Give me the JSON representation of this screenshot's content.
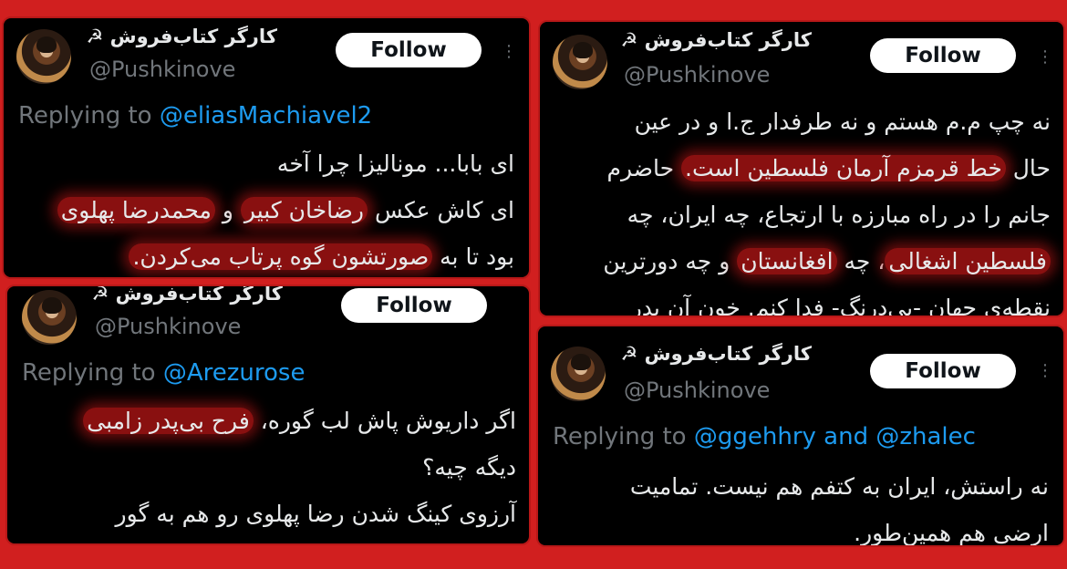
{
  "theme": {
    "background": "#d11f1f",
    "card_background": "#000000",
    "mention_color": "#1d9bf0",
    "highlight_color": "#be1616"
  },
  "tweets": [
    {
      "display_name": "کارگر کتاب‌فروش ☭",
      "handle": "@Pushkinove",
      "follow_label": "Follow",
      "replying_prefix": "Replying to",
      "mentions": [
        "@eliasMachiavel2"
      ],
      "lines": [
        {
          "before": "",
          "highlight": "",
          "after": "ای بابا... مونالیزا چرا آخه"
        },
        {
          "before": "ای کاش عکس ",
          "highlight": "رضاخان کبیر",
          "mid": " و ",
          "highlight2": "محمدرضا پهلوی",
          "after": ""
        },
        {
          "before": "بود تا به ",
          "highlight": "صورتشون گوه پرتاب می‌کردن.",
          "after": ""
        }
      ]
    },
    {
      "display_name": "کارگر کتاب‌فروش ☭",
      "handle": "@Pushkinove",
      "follow_label": "Follow",
      "replying_prefix": "Replying to",
      "mentions": [
        "@Arezurose"
      ],
      "lines": [
        {
          "before": "اگر داریوش پاش لب گوره، ",
          "highlight": "فرح بی‌پدر زامبی",
          "after": ""
        },
        {
          "before": "",
          "highlight": "",
          "after": "دیگه چیه؟"
        },
        {
          "before": "",
          "highlight": "",
          "after": "آرزوی کینگ شدن رضا پهلوی رو هم به گور"
        }
      ]
    },
    {
      "display_name": "کارگر کتاب‌فروش ☭",
      "handle": "@Pushkinove",
      "follow_label": "Follow",
      "lines": [
        {
          "before": "",
          "highlight": "",
          "after": "نه چپ م.م هستم و نه طرفدار ج.ا و در عین"
        },
        {
          "before": "حال ",
          "highlight": "خط قرمزم آرمان فلسطین است.",
          "after": " حاضرم"
        },
        {
          "before": "",
          "highlight": "",
          "after": "جانم را در راه مبارزه با ارتجاع، چه ایران، چه"
        },
        {
          "before": "",
          "highlight": "فلسطین اشغالی",
          "mid": "، چه ",
          "highlight2": "افغانستان",
          "after": " و چه دورترین"
        },
        {
          "before": "",
          "highlight": "",
          "after": "نقطه‌ی جهان -بی‌درنگ- فدا کنم. خون آن پدر"
        }
      ]
    },
    {
      "display_name": "کارگر کتاب‌فروش ☭",
      "handle": "@Pushkinove",
      "follow_label": "Follow",
      "replying_prefix": "Replying to",
      "mentions": [
        "@ggehhry",
        "@zhalec"
      ],
      "mention_joiner": "and",
      "lines": [
        {
          "before": "",
          "highlight": "",
          "after": "نه راستش، ایران به کتفم هم نیست. تمامیت"
        },
        {
          "before": "",
          "highlight": "",
          "after": "ارضی هم همین‌طور."
        }
      ]
    }
  ]
}
